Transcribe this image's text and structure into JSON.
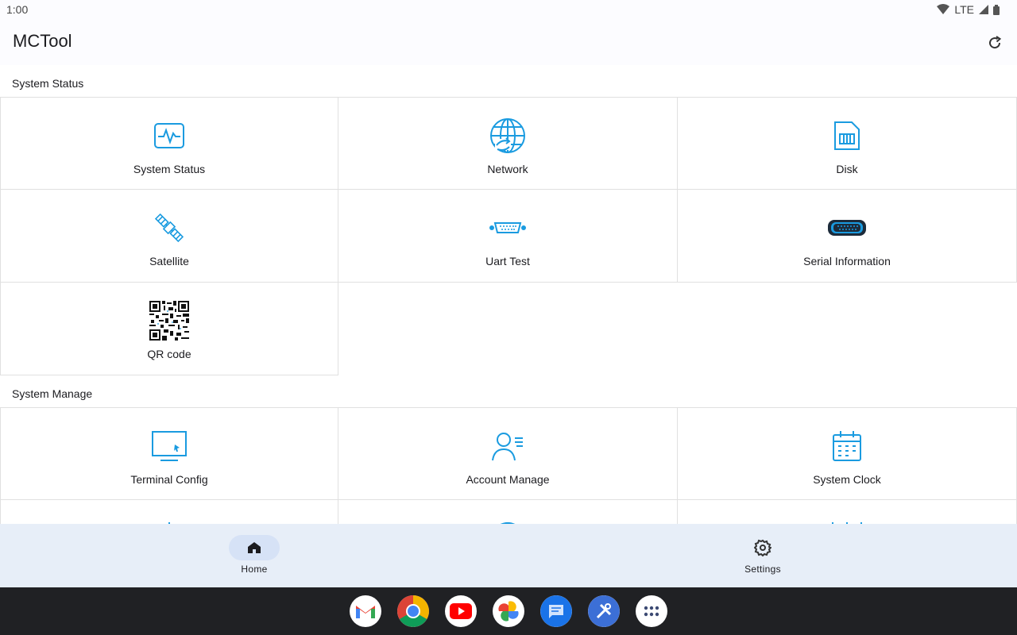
{
  "status_bar": {
    "time": "1:00",
    "network": "LTE"
  },
  "app_bar": {
    "title": "MCTool"
  },
  "sections": [
    {
      "title": "System Status",
      "items": [
        {
          "label": "System Status",
          "icon": "activity-monitor-icon"
        },
        {
          "label": "Network",
          "icon": "globe-network-icon"
        },
        {
          "label": "Disk",
          "icon": "sd-card-icon"
        },
        {
          "label": "Satellite",
          "icon": "satellite-icon"
        },
        {
          "label": "Uart Test",
          "icon": "serial-connector-icon"
        },
        {
          "label": "Serial Information",
          "icon": "serial-port-dark-icon"
        },
        {
          "label": "QR code",
          "icon": "qr-code-icon"
        }
      ]
    },
    {
      "title": "System Manage",
      "items": [
        {
          "label": "Terminal Config",
          "icon": "monitor-icon"
        },
        {
          "label": "Account Manage",
          "icon": "user-list-icon"
        },
        {
          "label": "System Clock",
          "icon": "calendar-icon"
        }
      ]
    }
  ],
  "bottom_nav": [
    {
      "label": "Home",
      "icon": "home-icon",
      "active": true
    },
    {
      "label": "Settings",
      "icon": "gear-icon",
      "active": false
    }
  ],
  "dock_apps": [
    "gmail-icon",
    "chrome-icon",
    "youtube-icon",
    "photos-icon",
    "messages-icon",
    "mctool-app-icon",
    "app-drawer-icon"
  ],
  "colors": {
    "accent": "#1a9be0",
    "nav_bg": "#e7eef8",
    "taskbar": "#202124"
  }
}
